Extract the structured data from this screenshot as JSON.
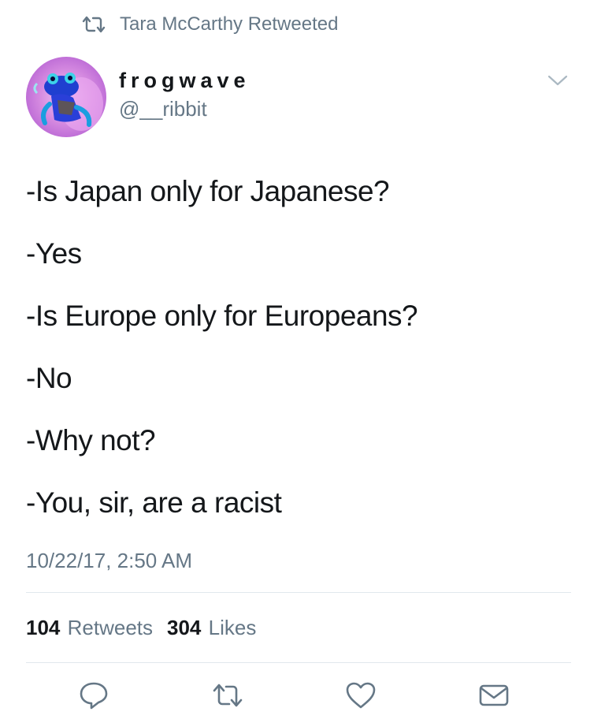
{
  "retweet_context": {
    "icon": "retweet-icon",
    "text": "Tara McCarthy Retweeted"
  },
  "author": {
    "display_name": "frogwave",
    "handle": "@__ribbit",
    "avatar_icon": "frog-avatar"
  },
  "menu_icon": "chevron-down-icon",
  "tweet": {
    "lines": [
      "-Is Japan only for Japanese?",
      "-Yes",
      "-Is Europe only for Europeans?",
      "-No",
      "-Why not?",
      "-You, sir, are a racist"
    ]
  },
  "timestamp": "10/22/17, 2:50 AM",
  "stats": {
    "retweets_count": "104",
    "retweets_label": "Retweets",
    "likes_count": "304",
    "likes_label": "Likes"
  },
  "actions": [
    {
      "name": "reply",
      "icon": "reply-icon"
    },
    {
      "name": "retweet",
      "icon": "retweet-icon"
    },
    {
      "name": "like",
      "icon": "heart-icon"
    },
    {
      "name": "direct-message",
      "icon": "envelope-icon"
    }
  ],
  "colors": {
    "text_primary": "#14171a",
    "text_secondary": "#657786",
    "divider": "#e1e8ed",
    "icon": "#657786"
  }
}
